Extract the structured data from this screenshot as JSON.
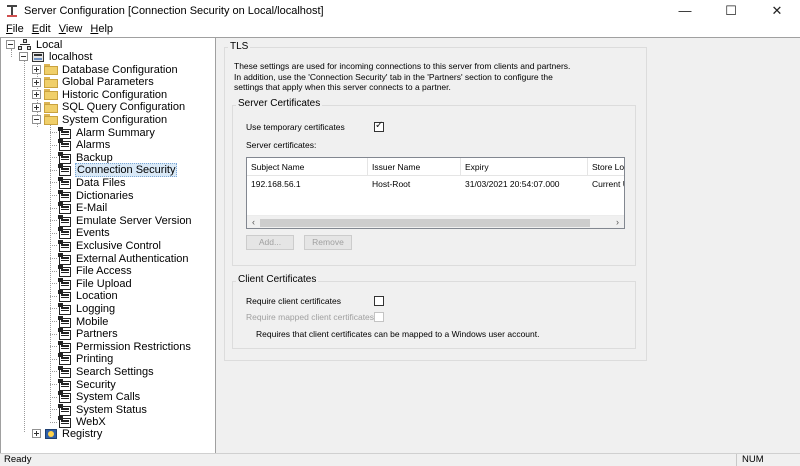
{
  "window": {
    "title": "Server Configuration [Connection Security on Local/localhost]",
    "minimize_glyph": "—",
    "maximize_glyph": "☐",
    "close_glyph": "✕"
  },
  "menu": [
    {
      "accel": "F",
      "rest": "ile"
    },
    {
      "accel": "E",
      "rest": "dit"
    },
    {
      "accel": "V",
      "rest": "iew"
    },
    {
      "accel": "H",
      "rest": "elp"
    }
  ],
  "tree": {
    "root": "Local",
    "host": "localhost",
    "folders": [
      "Database Configuration",
      "Global Parameters",
      "Historic Configuration",
      "SQL Query Configuration",
      "System Configuration"
    ],
    "system_items": [
      "Alarm Summary",
      "Alarms",
      "Backup",
      "Connection Security",
      "Data Files",
      "Dictionaries",
      "E-Mail",
      "Emulate Server Version",
      "Events",
      "Exclusive Control",
      "External Authentication",
      "File Access",
      "File Upload",
      "Location",
      "Logging",
      "Mobile",
      "Partners",
      "Permission Restrictions",
      "Printing",
      "Search Settings",
      "Security",
      "System Calls",
      "System Status",
      "WebX"
    ],
    "selected": "Connection Security",
    "registry": "Registry"
  },
  "tls": {
    "title": "TLS",
    "description_lines": [
      "These settings are used for incoming connections to this server from clients and partners.",
      "In addition, use the 'Connection Security' tab in the 'Partners' section to configure the",
      "settings that apply when this server connects to a partner."
    ],
    "server_certificates": {
      "title": "Server Certificates",
      "use_temp_label": "Use temporary certificates",
      "use_temp_checked": true,
      "list_label": "Server certificates:",
      "columns": [
        "Subject Name",
        "Issuer Name",
        "Expiry",
        "Store Loca"
      ],
      "rows": [
        [
          "192.168.56.1",
          "Host-Root",
          "31/03/2021 20:54:07.000",
          "Current U"
        ]
      ],
      "add_label": "Add...",
      "remove_label": "Remove"
    },
    "client_certificates": {
      "title": "Client Certificates",
      "require_label": "Require client certificates",
      "require_checked": false,
      "require_mapped_label": "Require mapped client certificates",
      "require_mapped_checked": false,
      "note": "Requires that client certificates can be mapped to a Windows user account."
    }
  },
  "status": {
    "text": "Ready",
    "num": "NUM"
  }
}
